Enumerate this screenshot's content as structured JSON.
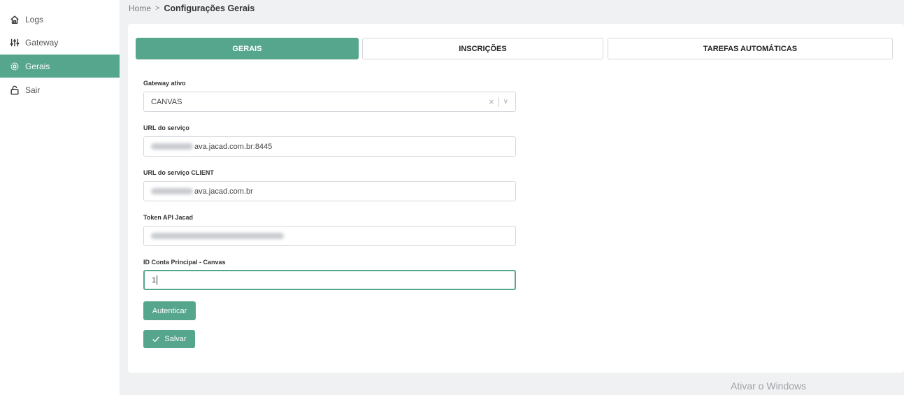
{
  "sidebar": {
    "items": [
      {
        "label": "Logs",
        "icon": "home-icon"
      },
      {
        "label": "Gateway",
        "icon": "sliders-icon"
      },
      {
        "label": "Gerais",
        "icon": "gear-icon"
      },
      {
        "label": "Sair",
        "icon": "unlock-icon"
      }
    ],
    "active": "Gerais"
  },
  "breadcrumb": {
    "home": "Home",
    "separator": ">",
    "current": "Configurações Gerais"
  },
  "tabs": [
    {
      "label": "GERAIS",
      "active": true
    },
    {
      "label": "INSCRIÇÕES",
      "active": false
    },
    {
      "label": "TAREFAS AUTOMÁTICAS",
      "active": false
    }
  ],
  "form": {
    "gateway": {
      "label": "Gateway ativo",
      "value": "CANVAS",
      "clear": "×",
      "chevron": "∨"
    },
    "service_url": {
      "label": "URL do serviço",
      "value": "ava.jacad.com.br:8445"
    },
    "client_url": {
      "label": "URL do serviço CLIENT",
      "value": "ava.jacad.com.br"
    },
    "token": {
      "label": "Token API Jacad"
    },
    "account_id": {
      "label": "ID Conta Principal - Canvas",
      "value": "1"
    }
  },
  "buttons": {
    "authenticate": "Autenticar",
    "save": "Salvar"
  },
  "watermark": "Ativar o Windows",
  "colors": {
    "accent": "#56a58d",
    "background": "#f0f1f3"
  }
}
